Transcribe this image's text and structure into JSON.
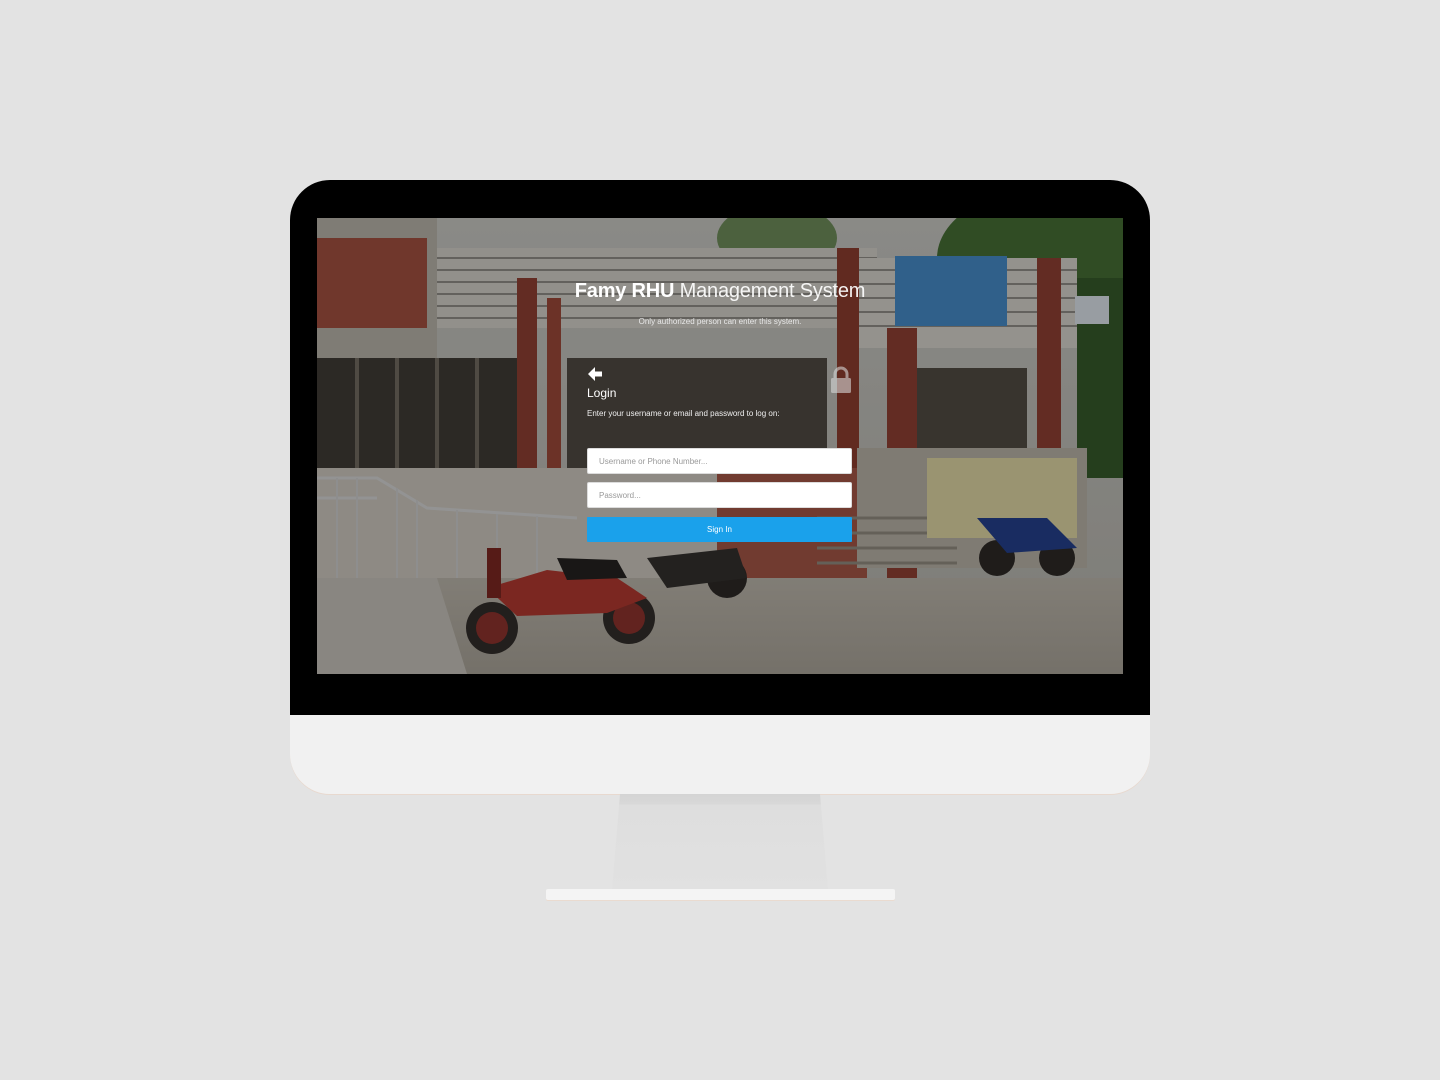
{
  "app": {
    "title_bold": "Famy RHU",
    "title_light": "Management System",
    "subtitle": "Only authorized person can enter this system."
  },
  "login": {
    "back_icon": "arrow-left-icon",
    "heading": "Login",
    "description": "Enter your username or email and password to log on:",
    "lock_icon": "lock-icon",
    "username_placeholder": "Username or Phone Number...",
    "username_value": "",
    "password_placeholder": "Password...",
    "password_value": "",
    "signin_label": "Sign In"
  },
  "colors": {
    "accent": "#1aa1eb",
    "background": "#e3e3e3",
    "bezel": "#000000",
    "chin": "#f1f1f1"
  }
}
